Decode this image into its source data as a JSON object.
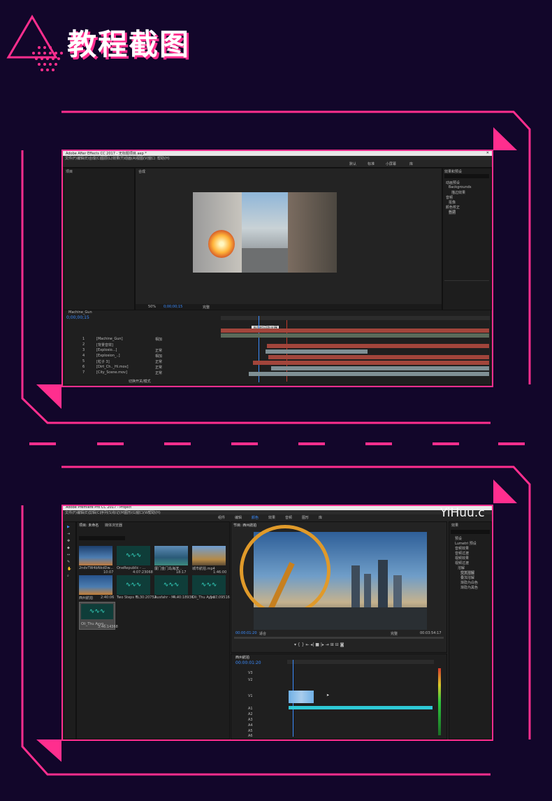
{
  "page": {
    "title": "教程截图",
    "accent": "#ff2e8e",
    "background": "#12062a"
  },
  "ae": {
    "window_title": "Adobe After Effects CC 2017 - 无标题项目.aep *",
    "menu": [
      "文件(F)",
      "编辑(E)",
      "合成(C)",
      "图层(L)",
      "效果(T)",
      "动画(A)",
      "视图(V)",
      "窗口",
      "帮助(H)"
    ],
    "workspaces": [
      "默认",
      "标准",
      "小屏幕",
      "库"
    ],
    "project_tab": "项目",
    "comp_tab": "合成",
    "right_panel": {
      "title": "效果和预设",
      "items": [
        "动画预设",
        "Backgrounds",
        "描边效果",
        "音频",
        "抠像",
        "颜色校正",
        "色调"
      ]
    },
    "timeline": {
      "comp_name": "Machine_Gun",
      "timecode": "0;00;00;15",
      "tooltip": "当前时间指示器"
    },
    "layers": [
      {
        "num": "1",
        "name": "[Machine_Gun]",
        "mode": "相加"
      },
      {
        "num": "2",
        "name": "[背景音效]",
        "mode": ""
      },
      {
        "num": "3",
        "name": "[Explosio...]",
        "mode": "正常"
      },
      {
        "num": "4",
        "name": "[Explosion_..]",
        "mode": "相加"
      },
      {
        "num": "5",
        "name": "[粒子 3]",
        "mode": "正常"
      },
      {
        "num": "6",
        "name": "[Dirt_Ch.._Hi.mov]",
        "mode": "正常"
      },
      {
        "num": "7",
        "name": "[City_Scene.mov]",
        "mode": "正常"
      }
    ],
    "footer": "切换开关/模式",
    "zoom": "50%",
    "quality": "完整",
    "time_readout": "0;00;00;15"
  },
  "pr": {
    "window_title": "Adobe Premiere Pro CC 2017 - Project",
    "menu": [
      "文件(F)",
      "编辑(E)",
      "剪辑(C)",
      "序列(S)",
      "标记(M)",
      "图形(G)",
      "窗口(W)",
      "帮助(H)"
    ],
    "workspaces": [
      "组件",
      "编辑",
      "颜色",
      "效果",
      "音频",
      "图形",
      "库"
    ],
    "project_tab": "项目: 未命名",
    "media_browser": "媒体浏览器",
    "bins": [
      {
        "name": "2ndvTW4bNkdDw...",
        "dur": "10:07",
        "kind": "video"
      },
      {
        "name": "OneRepublic - ...",
        "dur": "4:07:23068",
        "kind": "audio"
      },
      {
        "name": "厦门金门岛海滨...",
        "dur": "18:17",
        "kind": "video"
      },
      {
        "name": "城市航拍.mp4",
        "dur": "1:46:00",
        "kind": "video"
      },
      {
        "name": "西州航拍",
        "dur": "2:40:06",
        "kind": "video"
      },
      {
        "name": "Two Steps F...",
        "dur": "8:30:20752",
        "kind": "audio"
      },
      {
        "name": "Ausfahr - M...",
        "dur": "4:40:18936",
        "kind": "audio"
      },
      {
        "name": "Oli_Thu Ayyo...",
        "dur": "3:07:09516",
        "kind": "audio"
      },
      {
        "name": "Oli_Thu Ayyo...",
        "dur": "3:46:14368",
        "kind": "audio"
      }
    ],
    "program_tab": "节目: 西州航拍",
    "program_timecode": "00:00:01:20",
    "program_duration": "00:03:54:17",
    "fit": "适合",
    "quality": "完整",
    "sequence_tab": "西州航拍",
    "seq_timecode": "00:00:01:20",
    "tracks_video": [
      "V3",
      "V2",
      "V1"
    ],
    "tracks_audio": [
      "A1",
      "A2",
      "A3",
      "A4",
      "A5",
      "A6"
    ],
    "effects_title": "效果",
    "effects": [
      "预设",
      "Lumetri 预设",
      "音频效果",
      "音频过渡",
      "视频效果",
      "视频过渡",
      "溶解",
      "交叉溶解",
      "叠加溶解",
      "渐隐为白色",
      "渐隐为黑色"
    ],
    "watermark": "YiHuu.c"
  }
}
